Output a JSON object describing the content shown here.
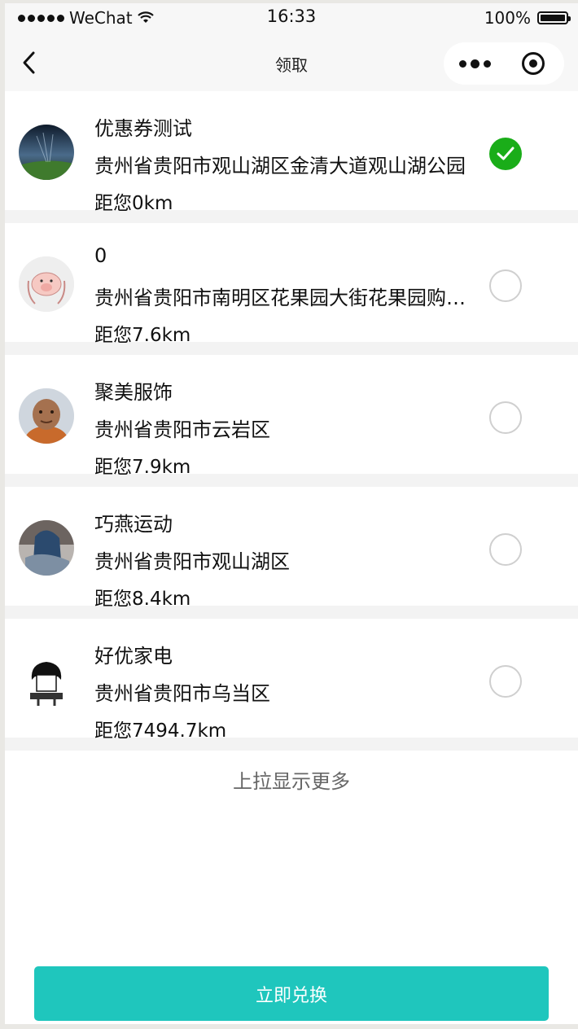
{
  "status_bar": {
    "carrier": "WeChat",
    "time": "16:33",
    "battery": "100%"
  },
  "nav": {
    "title": "领取"
  },
  "stores": [
    {
      "name": "优惠券测试",
      "address": "贵州省贵阳市观山湖区金清大道观山湖公园",
      "distance": "距您0km",
      "selected": true
    },
    {
      "name": "0",
      "address": "贵州省贵阳市南明区花果园大街花果园购物中心",
      "distance": "距您7.6km",
      "selected": false
    },
    {
      "name": "聚美服饰",
      "address": "贵州省贵阳市云岩区",
      "distance": "距您7.9km",
      "selected": false
    },
    {
      "name": "巧燕运动",
      "address": "贵州省贵阳市观山湖区",
      "distance": "距您8.4km",
      "selected": false
    },
    {
      "name": "好优家电",
      "address": "贵州省贵阳市乌当区",
      "distance": "距您7494.7km",
      "selected": false
    }
  ],
  "load_more_hint": "上拉显示更多",
  "redeem_button": "立即兑换",
  "colors": {
    "accent_button": "#1fc6bd",
    "selected_radio": "#1aad19"
  }
}
